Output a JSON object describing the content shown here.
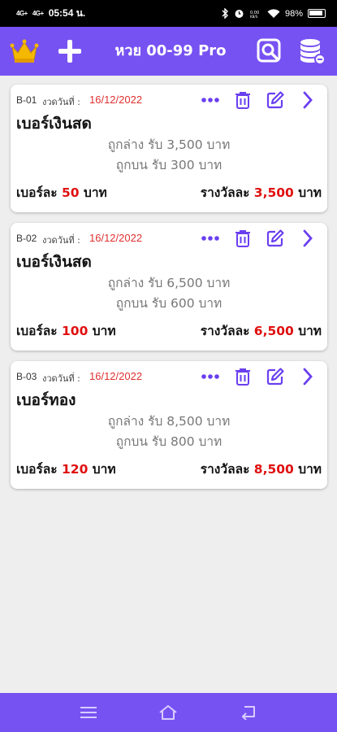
{
  "status_bar": {
    "signal_1": "4G+",
    "signal_2": "4G+",
    "time": "05:54 น.",
    "battery": "98%"
  },
  "app_bar": {
    "title": "หวย 00-99 Pro",
    "icons": [
      "crown-icon",
      "plus-icon",
      "search-doc-icon",
      "database-icon"
    ]
  },
  "labels": {
    "date_label": "งวดวันที่ :",
    "per_number": "เบอร์ละ",
    "prize_each": "รางวัลละ",
    "baht": "บาท"
  },
  "accent_colors": {
    "primary": "#7752f2",
    "highlight": "#e01010"
  },
  "cards": [
    {
      "code": "B-01",
      "date": "16/12/2022",
      "name": "เบอร์เงินสด",
      "line1": "ถูกล่าง รับ 3,500 บาท",
      "line2": "ถูกบน รับ 300 บาท",
      "price": "50",
      "prize": "3,500"
    },
    {
      "code": "B-02",
      "date": "16/12/2022",
      "name": "เบอร์เงินสด",
      "line1": "ถูกล่าง รับ 6,500 บาท",
      "line2": "ถูกบน รับ 600 บาท",
      "price": "100",
      "prize": "6,500"
    },
    {
      "code": "B-03",
      "date": "16/12/2022",
      "name": "เบอร์ทอง",
      "line1": "ถูกล่าง รับ 8,500 บาท",
      "line2": "ถูกบน รับ 800 บาท",
      "price": "120",
      "prize": "8,500"
    }
  ],
  "nav_bar": {
    "icons": [
      "menu-icon",
      "home-icon",
      "back-icon"
    ]
  }
}
